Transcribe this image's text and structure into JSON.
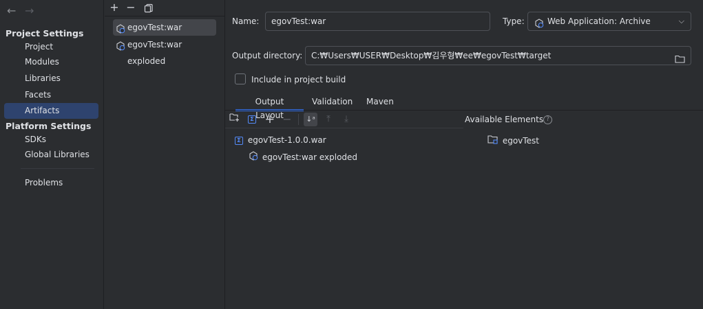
{
  "nav": {
    "back_icon": "arrow-left-icon",
    "forward_icon": "arrow-right-icon",
    "project_settings_heading": "Project Settings",
    "project_items": [
      "Project",
      "Modules",
      "Libraries",
      "Facets",
      "Artifacts"
    ],
    "selected_item": "Artifacts",
    "platform_settings_heading": "Platform Settings",
    "platform_items": [
      "SDKs",
      "Global Libraries"
    ],
    "other_items": [
      "Problems"
    ]
  },
  "artifact_list": {
    "toolbar": {
      "add": "+",
      "remove": "−",
      "copy_icon": "copy-icon"
    },
    "items": [
      "egovTest:war",
      "egovTest:war exploded"
    ],
    "selected": "egovTest:war"
  },
  "form": {
    "name_label": "Name:",
    "name_value": "egovTest:war",
    "type_label": "Type:",
    "type_value": "Web Application: Archive",
    "output_dir_label": "Output directory:",
    "output_dir_value": "C:₩Users₩USER₩Desktop₩김우형₩ee₩egovTest₩target",
    "include_label": "Include in project build",
    "include_checked": false
  },
  "tabs": [
    "Output Layout",
    "Validation",
    "Maven"
  ],
  "active_tab": "Output Layout",
  "layout": {
    "available_label": "Available Elements",
    "tree": {
      "root": "egovTest-1.0.0.war",
      "child": "egovTest:war exploded"
    },
    "available_items": [
      "egovTest"
    ]
  },
  "colors": {
    "accent": "#3574f0",
    "selection": "#2e436e",
    "background": "#2b2d30"
  }
}
